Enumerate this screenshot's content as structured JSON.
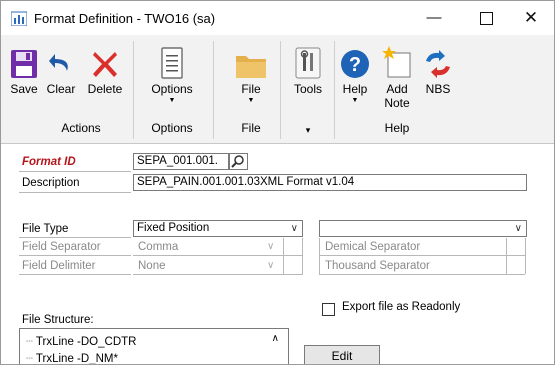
{
  "window": {
    "title": "Format Definition  -  TWO16 (sa)",
    "minimize_glyph": "—",
    "close_glyph": "✕"
  },
  "ribbon": {
    "actions": {
      "save": "Save",
      "clear": "Clear",
      "delete": "Delete",
      "group": "Actions"
    },
    "options": {
      "options": "Options",
      "group": "Options"
    },
    "file": {
      "file": "File",
      "group": "File"
    },
    "tools": {
      "tools": "Tools"
    },
    "help": {
      "help": "Help",
      "add_note_1": "Add",
      "add_note_2": "Note",
      "nbs": "NBS",
      "group": "Help"
    }
  },
  "form": {
    "format_id_label": "Format ID",
    "format_id_value": "SEPA_001.001.",
    "description_label": "Description",
    "description_value": "SEPA_PAIN.001.001.03XML Format v1.04",
    "file_type_label": "File Type",
    "file_type_value": "Fixed Position",
    "field_separator_label": "Field Separator",
    "field_separator_value": "Comma",
    "field_delimiter_label": "Field Delimiter",
    "field_delimiter_value": "None",
    "decimal_separator_label": "Demical Separator",
    "thousand_separator_label": "Thousand Separator",
    "file_structure_label": "File Structure:",
    "export_readonly_label": "Export file as Readonly",
    "tree_items": [
      "TrxLine -DO_CDTR",
      "TrxLine -D_NM*"
    ],
    "edit_button": "Edit"
  },
  "colors": {
    "format_id_red": "#b4161b",
    "ribbon_bg": "#f2f2f2",
    "save_purple": "#6f2da8",
    "clear_blue": "#1f5aa8",
    "delete_red": "#d9302c",
    "help_blue": "#1e63b6",
    "folder_tan": "#e3b04b"
  }
}
